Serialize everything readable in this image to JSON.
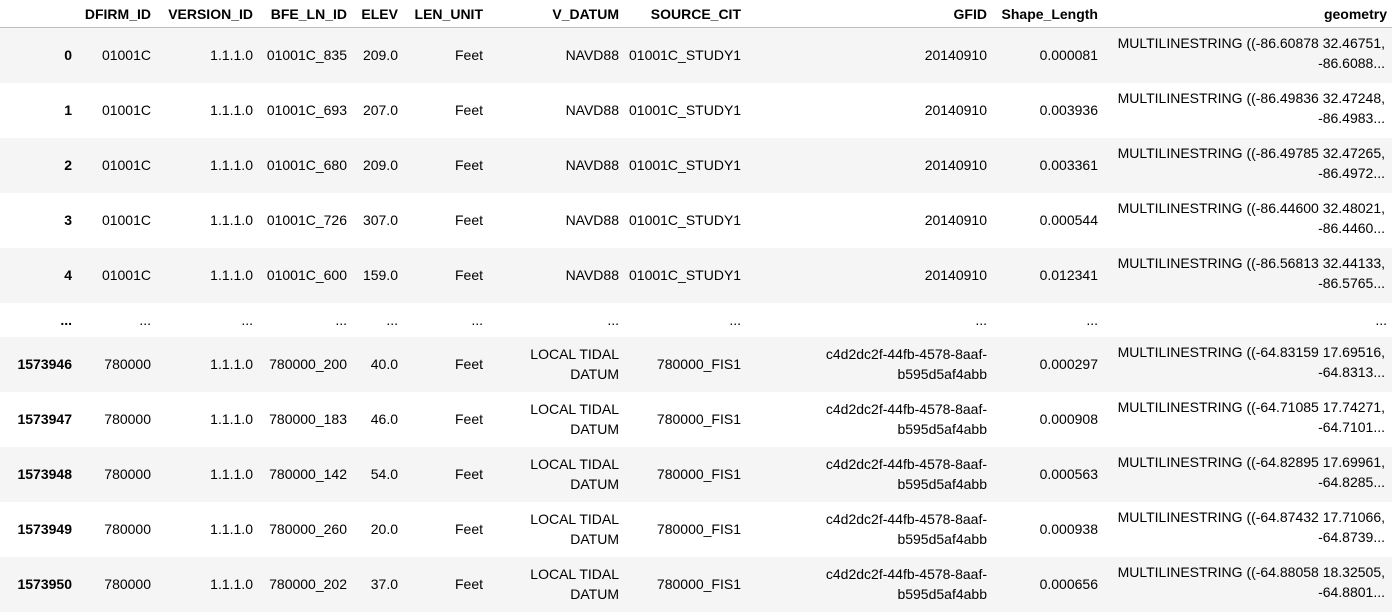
{
  "columns": [
    "",
    "DFIRM_ID",
    "VERSION_ID",
    "BFE_LN_ID",
    "ELEV",
    "LEN_UNIT",
    "V_DATUM",
    "SOURCE_CIT",
    "GFID",
    "Shape_Length",
    "geometry"
  ],
  "rows": [
    {
      "index": "0",
      "DFIRM_ID": "01001C",
      "VERSION_ID": "1.1.1.0",
      "BFE_LN_ID": "01001C_835",
      "ELEV": "209.0",
      "LEN_UNIT": "Feet",
      "V_DATUM": "NAVD88",
      "SOURCE_CIT": "01001C_STUDY1",
      "GFID": "20140910",
      "Shape_Length": "0.000081",
      "geometry": "MULTILINESTRING ((-86.60878 32.46751, -86.6088..."
    },
    {
      "index": "1",
      "DFIRM_ID": "01001C",
      "VERSION_ID": "1.1.1.0",
      "BFE_LN_ID": "01001C_693",
      "ELEV": "207.0",
      "LEN_UNIT": "Feet",
      "V_DATUM": "NAVD88",
      "SOURCE_CIT": "01001C_STUDY1",
      "GFID": "20140910",
      "Shape_Length": "0.003936",
      "geometry": "MULTILINESTRING ((-86.49836 32.47248, -86.4983..."
    },
    {
      "index": "2",
      "DFIRM_ID": "01001C",
      "VERSION_ID": "1.1.1.0",
      "BFE_LN_ID": "01001C_680",
      "ELEV": "209.0",
      "LEN_UNIT": "Feet",
      "V_DATUM": "NAVD88",
      "SOURCE_CIT": "01001C_STUDY1",
      "GFID": "20140910",
      "Shape_Length": "0.003361",
      "geometry": "MULTILINESTRING ((-86.49785 32.47265, -86.4972..."
    },
    {
      "index": "3",
      "DFIRM_ID": "01001C",
      "VERSION_ID": "1.1.1.0",
      "BFE_LN_ID": "01001C_726",
      "ELEV": "307.0",
      "LEN_UNIT": "Feet",
      "V_DATUM": "NAVD88",
      "SOURCE_CIT": "01001C_STUDY1",
      "GFID": "20140910",
      "Shape_Length": "0.000544",
      "geometry": "MULTILINESTRING ((-86.44600 32.48021, -86.4460..."
    },
    {
      "index": "4",
      "DFIRM_ID": "01001C",
      "VERSION_ID": "1.1.1.0",
      "BFE_LN_ID": "01001C_600",
      "ELEV": "159.0",
      "LEN_UNIT": "Feet",
      "V_DATUM": "NAVD88",
      "SOURCE_CIT": "01001C_STUDY1",
      "GFID": "20140910",
      "Shape_Length": "0.012341",
      "geometry": "MULTILINESTRING ((-86.56813 32.44133, -86.5765..."
    },
    {
      "ellipsis": true,
      "index": "...",
      "DFIRM_ID": "...",
      "VERSION_ID": "...",
      "BFE_LN_ID": "...",
      "ELEV": "...",
      "LEN_UNIT": "...",
      "V_DATUM": "...",
      "SOURCE_CIT": "...",
      "GFID": "...",
      "Shape_Length": "...",
      "geometry": "..."
    },
    {
      "index": "1573946",
      "DFIRM_ID": "780000",
      "VERSION_ID": "1.1.1.0",
      "BFE_LN_ID": "780000_200",
      "ELEV": "40.0",
      "LEN_UNIT": "Feet",
      "V_DATUM": "LOCAL TIDAL DATUM",
      "SOURCE_CIT": "780000_FIS1",
      "GFID": "c4d2dc2f-44fb-4578-8aaf-b595d5af4abb",
      "Shape_Length": "0.000297",
      "geometry": "MULTILINESTRING ((-64.83159 17.69516, -64.8313..."
    },
    {
      "index": "1573947",
      "DFIRM_ID": "780000",
      "VERSION_ID": "1.1.1.0",
      "BFE_LN_ID": "780000_183",
      "ELEV": "46.0",
      "LEN_UNIT": "Feet",
      "V_DATUM": "LOCAL TIDAL DATUM",
      "SOURCE_CIT": "780000_FIS1",
      "GFID": "c4d2dc2f-44fb-4578-8aaf-b595d5af4abb",
      "Shape_Length": "0.000908",
      "geometry": "MULTILINESTRING ((-64.71085 17.74271, -64.7101..."
    },
    {
      "index": "1573948",
      "DFIRM_ID": "780000",
      "VERSION_ID": "1.1.1.0",
      "BFE_LN_ID": "780000_142",
      "ELEV": "54.0",
      "LEN_UNIT": "Feet",
      "V_DATUM": "LOCAL TIDAL DATUM",
      "SOURCE_CIT": "780000_FIS1",
      "GFID": "c4d2dc2f-44fb-4578-8aaf-b595d5af4abb",
      "Shape_Length": "0.000563",
      "geometry": "MULTILINESTRING ((-64.82895 17.69961, -64.8285..."
    },
    {
      "index": "1573949",
      "DFIRM_ID": "780000",
      "VERSION_ID": "1.1.1.0",
      "BFE_LN_ID": "780000_260",
      "ELEV": "20.0",
      "LEN_UNIT": "Feet",
      "V_DATUM": "LOCAL TIDAL DATUM",
      "SOURCE_CIT": "780000_FIS1",
      "GFID": "c4d2dc2f-44fb-4578-8aaf-b595d5af4abb",
      "Shape_Length": "0.000938",
      "geometry": "MULTILINESTRING ((-64.87432 17.71066, -64.8739..."
    },
    {
      "index": "1573950",
      "DFIRM_ID": "780000",
      "VERSION_ID": "1.1.1.0",
      "BFE_LN_ID": "780000_202",
      "ELEV": "37.0",
      "LEN_UNIT": "Feet",
      "V_DATUM": "LOCAL TIDAL DATUM",
      "SOURCE_CIT": "780000_FIS1",
      "GFID": "c4d2dc2f-44fb-4578-8aaf-b595d5af4abb",
      "Shape_Length": "0.000656",
      "geometry": "MULTILINESTRING ((-64.88058 18.32505, -64.8801..."
    }
  ]
}
